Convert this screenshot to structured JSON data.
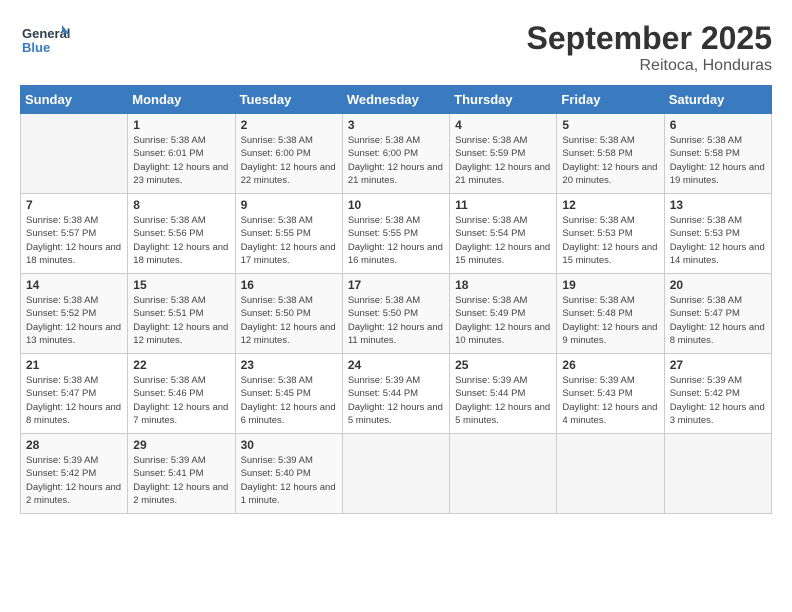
{
  "header": {
    "logo_text_general": "General",
    "logo_text_blue": "Blue",
    "month": "September 2025",
    "location": "Reitoca, Honduras"
  },
  "days_of_week": [
    "Sunday",
    "Monday",
    "Tuesday",
    "Wednesday",
    "Thursday",
    "Friday",
    "Saturday"
  ],
  "weeks": [
    [
      {
        "day": "",
        "info": ""
      },
      {
        "day": "1",
        "info": "Sunrise: 5:38 AM\nSunset: 6:01 PM\nDaylight: 12 hours\nand 23 minutes."
      },
      {
        "day": "2",
        "info": "Sunrise: 5:38 AM\nSunset: 6:00 PM\nDaylight: 12 hours\nand 22 minutes."
      },
      {
        "day": "3",
        "info": "Sunrise: 5:38 AM\nSunset: 6:00 PM\nDaylight: 12 hours\nand 21 minutes."
      },
      {
        "day": "4",
        "info": "Sunrise: 5:38 AM\nSunset: 5:59 PM\nDaylight: 12 hours\nand 21 minutes."
      },
      {
        "day": "5",
        "info": "Sunrise: 5:38 AM\nSunset: 5:58 PM\nDaylight: 12 hours\nand 20 minutes."
      },
      {
        "day": "6",
        "info": "Sunrise: 5:38 AM\nSunset: 5:58 PM\nDaylight: 12 hours\nand 19 minutes."
      }
    ],
    [
      {
        "day": "7",
        "info": "Sunrise: 5:38 AM\nSunset: 5:57 PM\nDaylight: 12 hours\nand 18 minutes."
      },
      {
        "day": "8",
        "info": "Sunrise: 5:38 AM\nSunset: 5:56 PM\nDaylight: 12 hours\nand 18 minutes."
      },
      {
        "day": "9",
        "info": "Sunrise: 5:38 AM\nSunset: 5:55 PM\nDaylight: 12 hours\nand 17 minutes."
      },
      {
        "day": "10",
        "info": "Sunrise: 5:38 AM\nSunset: 5:55 PM\nDaylight: 12 hours\nand 16 minutes."
      },
      {
        "day": "11",
        "info": "Sunrise: 5:38 AM\nSunset: 5:54 PM\nDaylight: 12 hours\nand 15 minutes."
      },
      {
        "day": "12",
        "info": "Sunrise: 5:38 AM\nSunset: 5:53 PM\nDaylight: 12 hours\nand 15 minutes."
      },
      {
        "day": "13",
        "info": "Sunrise: 5:38 AM\nSunset: 5:53 PM\nDaylight: 12 hours\nand 14 minutes."
      }
    ],
    [
      {
        "day": "14",
        "info": "Sunrise: 5:38 AM\nSunset: 5:52 PM\nDaylight: 12 hours\nand 13 minutes."
      },
      {
        "day": "15",
        "info": "Sunrise: 5:38 AM\nSunset: 5:51 PM\nDaylight: 12 hours\nand 12 minutes."
      },
      {
        "day": "16",
        "info": "Sunrise: 5:38 AM\nSunset: 5:50 PM\nDaylight: 12 hours\nand 12 minutes."
      },
      {
        "day": "17",
        "info": "Sunrise: 5:38 AM\nSunset: 5:50 PM\nDaylight: 12 hours\nand 11 minutes."
      },
      {
        "day": "18",
        "info": "Sunrise: 5:38 AM\nSunset: 5:49 PM\nDaylight: 12 hours\nand 10 minutes."
      },
      {
        "day": "19",
        "info": "Sunrise: 5:38 AM\nSunset: 5:48 PM\nDaylight: 12 hours\nand 9 minutes."
      },
      {
        "day": "20",
        "info": "Sunrise: 5:38 AM\nSunset: 5:47 PM\nDaylight: 12 hours\nand 8 minutes."
      }
    ],
    [
      {
        "day": "21",
        "info": "Sunrise: 5:38 AM\nSunset: 5:47 PM\nDaylight: 12 hours\nand 8 minutes."
      },
      {
        "day": "22",
        "info": "Sunrise: 5:38 AM\nSunset: 5:46 PM\nDaylight: 12 hours\nand 7 minutes."
      },
      {
        "day": "23",
        "info": "Sunrise: 5:38 AM\nSunset: 5:45 PM\nDaylight: 12 hours\nand 6 minutes."
      },
      {
        "day": "24",
        "info": "Sunrise: 5:39 AM\nSunset: 5:44 PM\nDaylight: 12 hours\nand 5 minutes."
      },
      {
        "day": "25",
        "info": "Sunrise: 5:39 AM\nSunset: 5:44 PM\nDaylight: 12 hours\nand 5 minutes."
      },
      {
        "day": "26",
        "info": "Sunrise: 5:39 AM\nSunset: 5:43 PM\nDaylight: 12 hours\nand 4 minutes."
      },
      {
        "day": "27",
        "info": "Sunrise: 5:39 AM\nSunset: 5:42 PM\nDaylight: 12 hours\nand 3 minutes."
      }
    ],
    [
      {
        "day": "28",
        "info": "Sunrise: 5:39 AM\nSunset: 5:42 PM\nDaylight: 12 hours\nand 2 minutes."
      },
      {
        "day": "29",
        "info": "Sunrise: 5:39 AM\nSunset: 5:41 PM\nDaylight: 12 hours\nand 2 minutes."
      },
      {
        "day": "30",
        "info": "Sunrise: 5:39 AM\nSunset: 5:40 PM\nDaylight: 12 hours\nand 1 minute."
      },
      {
        "day": "",
        "info": ""
      },
      {
        "day": "",
        "info": ""
      },
      {
        "day": "",
        "info": ""
      },
      {
        "day": "",
        "info": ""
      }
    ]
  ]
}
